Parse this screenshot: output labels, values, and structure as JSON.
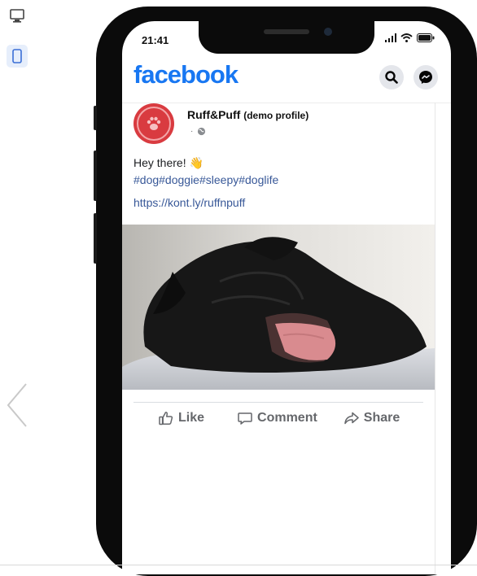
{
  "status_bar": {
    "time": "21:41"
  },
  "header": {
    "logo_text": "facebook"
  },
  "post": {
    "profile_name": "Ruff&Puff",
    "profile_note": "(demo profile)",
    "meta_dot": "·",
    "text": "Hey there! 👋",
    "hashtags": "#dog#doggie#sleepy#doglife",
    "link": "https://kont.ly/ruffnpuff"
  },
  "actions": {
    "like_label": "Like",
    "comment_label": "Comment",
    "share_label": "Share"
  },
  "icons": {
    "desktop": "desktop-icon",
    "mobile": "mobile-icon",
    "prev": "chevron-left-icon",
    "search": "search-icon",
    "messenger": "messenger-icon",
    "globe": "globe-icon",
    "like": "thumbs-up-icon",
    "comment": "comment-icon",
    "share": "share-icon",
    "signal": "signal-icon",
    "wifi": "wifi-icon",
    "battery": "battery-icon"
  },
  "colors": {
    "brand": "#1877f2",
    "link": "#385898",
    "avatar": "#d93b40",
    "action_text": "#65676b"
  }
}
